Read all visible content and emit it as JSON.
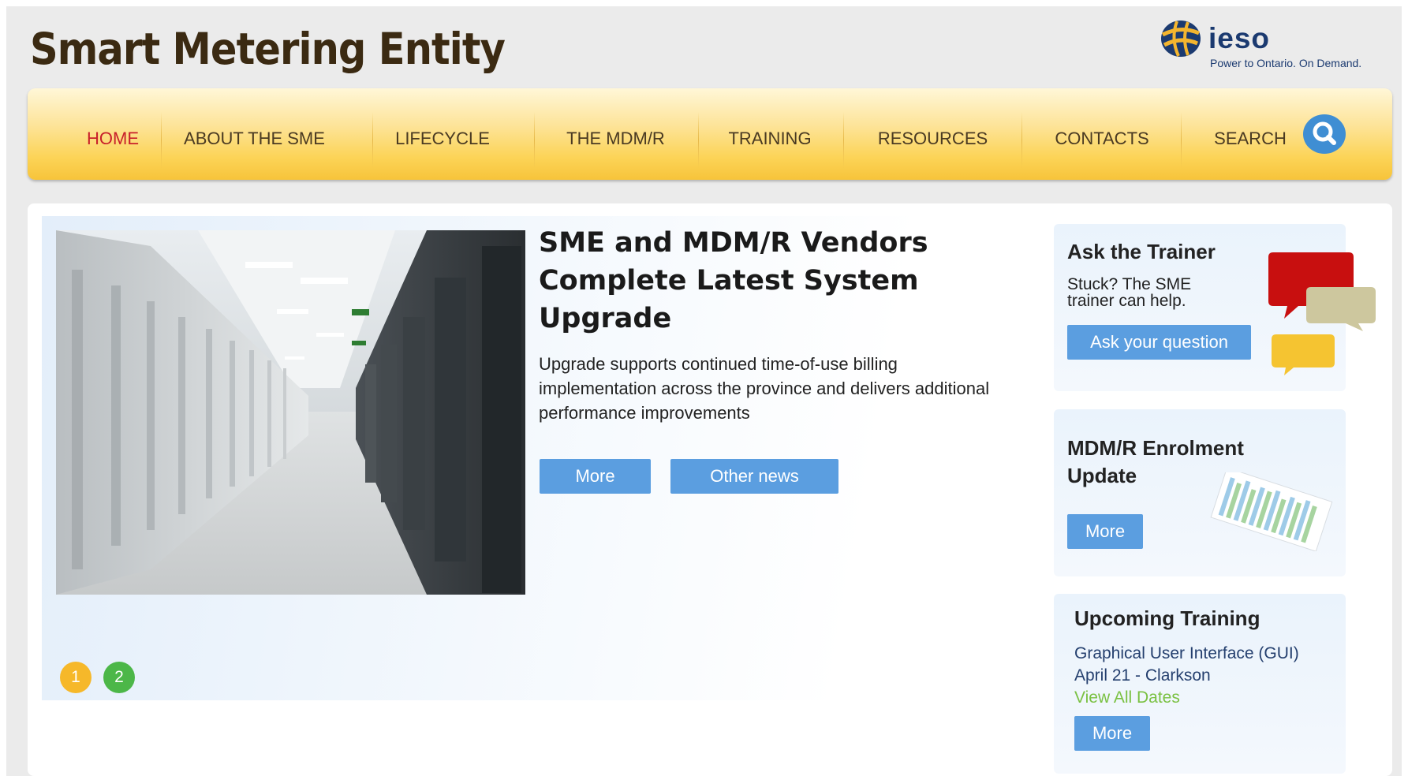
{
  "header": {
    "site_title": "Smart Metering Entity",
    "logo_text": "ieso",
    "logo_tagline": "Power to Ontario. On Demand."
  },
  "nav": {
    "items": [
      "HOME",
      "ABOUT THE SME",
      "LIFECYCLE",
      "THE MDM/R",
      "TRAINING",
      "RESOURCES",
      "CONTACTS",
      "SEARCH"
    ],
    "active": "HOME"
  },
  "feature": {
    "headline": "SME and MDM/R Vendors Complete Latest System Upgrade",
    "summary": "Upgrade supports continued time-of-use billing implementation across the province and delivers additional performance improvements",
    "more_label": "More",
    "other_news_label": "Other news",
    "pagination": [
      "1",
      "2"
    ]
  },
  "sidebar": {
    "ask_trainer": {
      "title": "Ask the Trainer",
      "text_line1": "Stuck? The SME",
      "text_line2": "trainer can help.",
      "button": "Ask your question"
    },
    "enrolment": {
      "title_line1": "MDM/R Enrolment",
      "title_line2": "Update",
      "button": "More"
    },
    "training": {
      "title": "Upcoming Training",
      "course": "Graphical User Interface (GUI)",
      "date": "April 21 - Clarkson",
      "view_all": "View All Dates",
      "button": "More"
    }
  },
  "colors": {
    "accent_blue": "#5b9ee0",
    "nav_active": "#c8202a",
    "dot_1": "#f6b82a",
    "dot_2": "#4cb748"
  }
}
